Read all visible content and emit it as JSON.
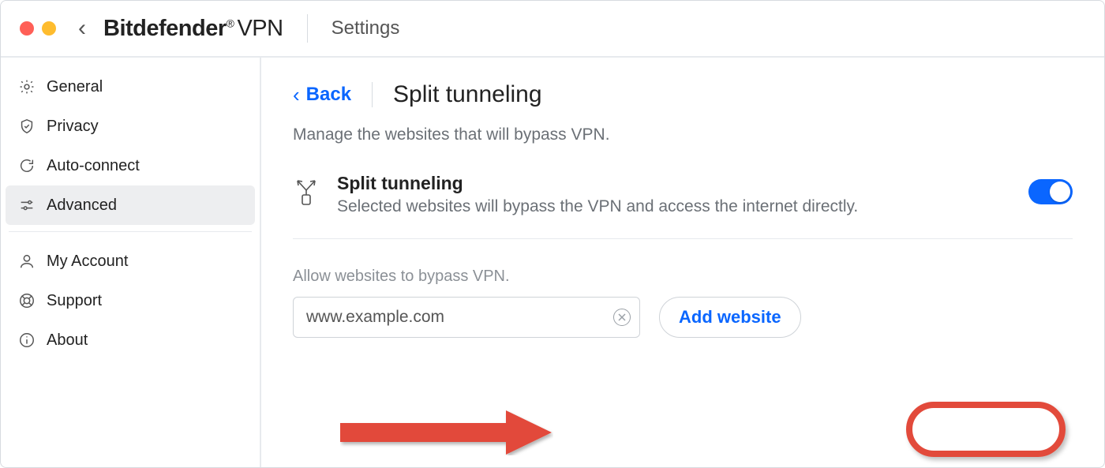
{
  "titlebar": {
    "brand_main": "Bitdefender",
    "brand_suffix": "VPN",
    "section": "Settings"
  },
  "sidebar": {
    "items": [
      {
        "label": "General"
      },
      {
        "label": "Privacy"
      },
      {
        "label": "Auto-connect"
      },
      {
        "label": "Advanced"
      }
    ],
    "items2": [
      {
        "label": "My Account"
      },
      {
        "label": "Support"
      },
      {
        "label": "About"
      }
    ]
  },
  "main": {
    "back_label": "Back",
    "page_title": "Split tunneling",
    "description": "Manage the websites that will bypass VPN.",
    "feature": {
      "title": "Split tunneling",
      "subtitle": "Selected websites will bypass the VPN and access the internet directly.",
      "enabled": true
    },
    "allow_label": "Allow websites to bypass VPN.",
    "input_value": "www.example.com",
    "add_label": "Add website"
  }
}
